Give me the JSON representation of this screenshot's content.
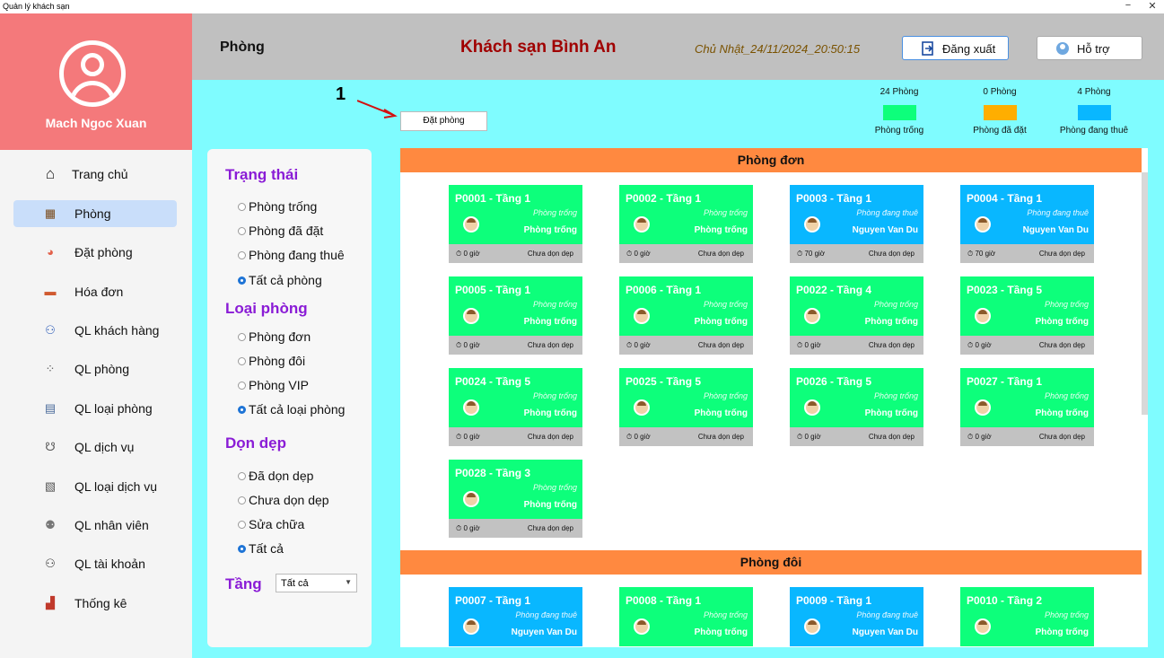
{
  "window": {
    "title": "Quản lý khách sạn",
    "minimize": "−",
    "close": "✕"
  },
  "profile": {
    "name": "Mach Ngoc Xuan"
  },
  "sidebar": {
    "items": [
      {
        "label": "Trang chủ",
        "icon": "⌂"
      },
      {
        "label": "Phòng",
        "icon": "▦"
      },
      {
        "label": "Đặt phòng",
        "icon": "◕"
      },
      {
        "label": "Hóa đơn",
        "icon": "▬"
      },
      {
        "label": "QL khách hàng",
        "icon": "⚇"
      },
      {
        "label": "QL phòng",
        "icon": "⁘"
      },
      {
        "label": "QL loại phòng",
        "icon": "▤"
      },
      {
        "label": "QL dịch vụ",
        "icon": "☋"
      },
      {
        "label": "QL loại dịch vụ",
        "icon": "▧"
      },
      {
        "label": "QL nhân viên",
        "icon": "⚉"
      },
      {
        "label": "QL tài khoản",
        "icon": "⚇"
      },
      {
        "label": "Thống kê",
        "icon": "▟"
      }
    ]
  },
  "header": {
    "title": "Phòng",
    "hotel_name": "Khách sạn Bình An",
    "datetime": "Chủ Nhật_24/11/2024_20:50:15",
    "logout_label": "Đăng xuất",
    "help_label": "Hỗ trợ"
  },
  "annotation": {
    "number": "1"
  },
  "toolbar": {
    "book_label": "Đặt phòng"
  },
  "legend": [
    {
      "count": "24 Phòng",
      "label": "Phòng trống",
      "color": "#0dff7b"
    },
    {
      "count": "0 Phòng",
      "label": "Phòng đã đặt",
      "color": "#ffae00"
    },
    {
      "count": "4 Phòng",
      "label": "Phòng đang thuê",
      "color": "#09b7ff"
    }
  ],
  "filters": {
    "status_title": "Trạng thái",
    "status_options": [
      "Phòng trống",
      "Phòng đã đặt",
      "Phòng đang thuê",
      "Tất cả phòng"
    ],
    "type_title": "Loại phòng",
    "type_options": [
      "Phòng đơn",
      "Phòng đôi",
      "Phòng VIP",
      "Tất cả loại phòng"
    ],
    "clean_title": "Dọn dẹp",
    "clean_options": [
      "Đã dọn dẹp",
      "Chưa dọn dẹp",
      "Sửa chữa",
      "Tất cả"
    ],
    "floor_title": "Tầng",
    "floor_value": "Tất cả"
  },
  "sections": {
    "single": "Phòng đơn",
    "double": "Phòng đôi"
  },
  "rooms": [
    {
      "id": "P0001  - Tầng 1",
      "status": "Phòng trống",
      "occupant": "Phòng trống",
      "time": "⏱ 0 giờ",
      "clean": "Chưa dọn dẹp"
    },
    {
      "id": "P0002  - Tầng 1",
      "status": "Phòng trống",
      "occupant": "Phòng trống",
      "time": "⏱ 0 giờ",
      "clean": "Chưa dọn dẹp"
    },
    {
      "id": "P0003  - Tầng 1",
      "status": "Phòng đang thuê",
      "occupant": "Nguyen Van Du",
      "time": "⏱ 70 giờ",
      "clean": "Chưa dọn dẹp"
    },
    {
      "id": "P0004  - Tầng 1",
      "status": "Phòng đang thuê",
      "occupant": "Nguyen Van Du",
      "time": "⏱ 70 giờ",
      "clean": "Chưa dọn dẹp"
    },
    {
      "id": "P0005  - Tầng 1",
      "status": "Phòng trống",
      "occupant": "Phòng trống",
      "time": "⏱ 0 giờ",
      "clean": "Chưa dọn dẹp"
    },
    {
      "id": "P0006  - Tầng 1",
      "status": "Phòng trống",
      "occupant": "Phòng trống",
      "time": "⏱ 0 giờ",
      "clean": "Chưa dọn dẹp"
    },
    {
      "id": "P0022  - Tầng 4",
      "status": "Phòng trống",
      "occupant": "Phòng trống",
      "time": "⏱ 0 giờ",
      "clean": "Chưa dọn dẹp"
    },
    {
      "id": "P0023  - Tầng 5",
      "status": "Phòng trống",
      "occupant": "Phòng trống",
      "time": "⏱ 0 giờ",
      "clean": "Chưa dọn dẹp"
    },
    {
      "id": "P0024  - Tầng 5",
      "status": "Phòng trống",
      "occupant": "Phòng trống",
      "time": "⏱ 0 giờ",
      "clean": "Chưa dọn dẹp"
    },
    {
      "id": "P0025  - Tầng 5",
      "status": "Phòng trống",
      "occupant": "Phòng trống",
      "time": "⏱ 0 giờ",
      "clean": "Chưa dọn dẹp"
    },
    {
      "id": "P0026  - Tầng 5",
      "status": "Phòng trống",
      "occupant": "Phòng trống",
      "time": "⏱ 0 giờ",
      "clean": "Chưa dọn dẹp"
    },
    {
      "id": "P0027  - Tầng 1",
      "status": "Phòng trống",
      "occupant": "Phòng trống",
      "time": "⏱ 0 giờ",
      "clean": "Chưa dọn dẹp"
    },
    {
      "id": "P0028  - Tầng 3",
      "status": "Phòng trống",
      "occupant": "Phòng trống",
      "time": "⏱ 0 giờ",
      "clean": "Chưa dọn dẹp"
    },
    {
      "id": "P0007  - Tầng 1",
      "status": "Phòng đang thuê",
      "occupant": "Nguyen Van Du"
    },
    {
      "id": "P0008  - Tầng 1",
      "status": "Phòng trống",
      "occupant": "Phòng trống"
    },
    {
      "id": "P0009  - Tầng 1",
      "status": "Phòng đang thuê",
      "occupant": "Nguyen Van Du"
    },
    {
      "id": "P0010  - Tầng 2",
      "status": "Phòng trống",
      "occupant": "Phòng trống"
    }
  ]
}
